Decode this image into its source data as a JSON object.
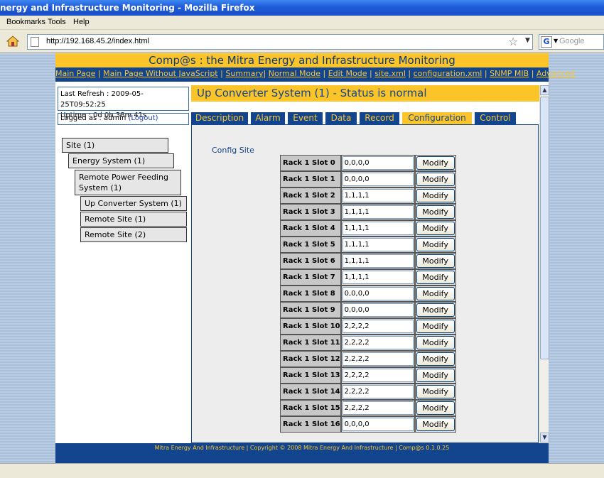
{
  "window": {
    "title": "nergy and Infrastructure Monitoring - Mozilla Firefox"
  },
  "menu": [
    "Bookmarks",
    "Tools",
    "Help"
  ],
  "browser": {
    "url": "http://192.168.45.2/index.html",
    "search_placeholder": "Google",
    "search_engine_glyph": "G"
  },
  "header": {
    "title": "Comp@s : the Mitra Energy and Infrastructure Monitoring",
    "links": [
      "Main Page",
      "Main Page Without JavaScript",
      "Summary",
      "Normal Mode",
      "Edit Mode",
      "site.xml",
      "configuration.xml",
      "SNMP MIB",
      "Advanced"
    ],
    "separators": [
      "|",
      "|",
      "|",
      "|",
      "|",
      "|",
      "|",
      "|"
    ]
  },
  "info": {
    "last_refresh": "Last Refresh : 2009-05-25T09:52:25",
    "uptime": "Uptime : 0d 0h 38m 41s",
    "logged_as": "Logged as : admin",
    "logout": "(Logout)"
  },
  "tree": [
    "Site (1)",
    "Energy System (1)",
    "Remote Power Feeding System (1)",
    "Up Converter System (1)",
    "Remote Site (1)",
    "Remote Site (2)"
  ],
  "status": "Up Converter System (1) - Status is normal",
  "tabs": [
    "Description",
    "Alarm",
    "Event",
    "Data",
    "Record",
    "Configuration",
    "Control"
  ],
  "active_tab": "Configuration",
  "config": {
    "title": "Config Site",
    "button_label": "Modify",
    "rows": [
      {
        "label": "Rack 1 Slot 0",
        "value": "0,0,0,0"
      },
      {
        "label": "Rack 1 Slot 1",
        "value": "0,0,0,0"
      },
      {
        "label": "Rack 1 Slot 2",
        "value": "1,1,1,1"
      },
      {
        "label": "Rack 1 Slot 3",
        "value": "1,1,1,1"
      },
      {
        "label": "Rack 1 Slot 4",
        "value": "1,1,1,1"
      },
      {
        "label": "Rack 1 Slot 5",
        "value": "1,1,1,1"
      },
      {
        "label": "Rack 1 Slot 6",
        "value": "1,1,1,1"
      },
      {
        "label": "Rack 1 Slot 7",
        "value": "1,1,1,1"
      },
      {
        "label": "Rack 1 Slot 8",
        "value": "0,0,0,0"
      },
      {
        "label": "Rack 1 Slot 9",
        "value": "0,0,0,0"
      },
      {
        "label": "Rack 1 Slot 10",
        "value": "2,2,2,2"
      },
      {
        "label": "Rack 1 Slot 11",
        "value": "2,2,2,2"
      },
      {
        "label": "Rack 1 Slot 12",
        "value": "2,2,2,2"
      },
      {
        "label": "Rack 1 Slot 13",
        "value": "2,2,2,2"
      },
      {
        "label": "Rack 1 Slot 14",
        "value": "2,2,2,2"
      },
      {
        "label": "Rack 1 Slot 15",
        "value": "2,2,2,2"
      },
      {
        "label": "Rack 1 Slot 16",
        "value": "0,0,0,0"
      }
    ]
  },
  "footer": {
    "link": "Mitra Energy And Infrastructure",
    "text": " | Copyright © 2008 Mitra Energy And Infrastructure | Comp@s 0.1.0.25"
  }
}
